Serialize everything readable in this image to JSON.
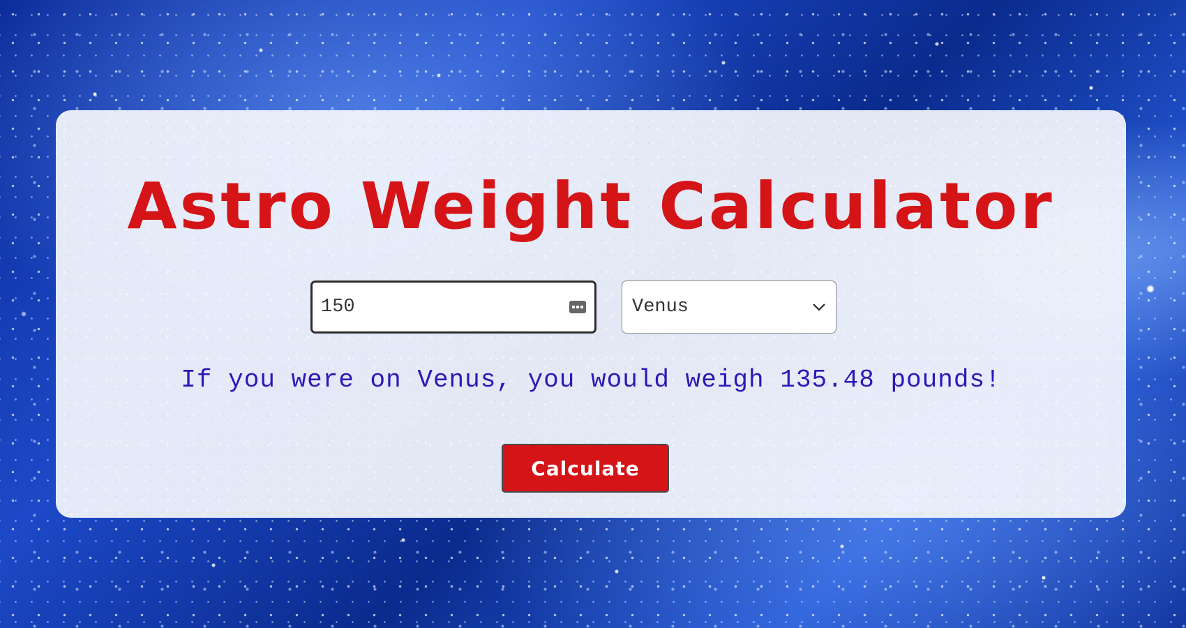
{
  "page": {
    "title": "Astro Weight Calculator"
  },
  "form": {
    "weight_value": "150",
    "planet_selected": "Venus",
    "calculate_label": "Calculate"
  },
  "result": {
    "message": "If you were on Venus, you would weigh 135.48 pounds!"
  },
  "icons": {
    "input_icon": "keypad-icon",
    "select_icon": "chevron-down-icon"
  },
  "colors": {
    "title": "#d51417",
    "result_text": "#2c18b8",
    "button_bg": "#d51417",
    "button_text": "#ffffff",
    "background": "#1d49c8"
  }
}
